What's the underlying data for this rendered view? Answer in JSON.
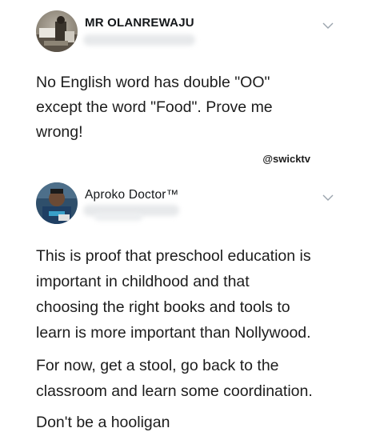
{
  "tweets": [
    {
      "author": "MR OLANREWAJU",
      "text": "No English word has double \"OO\"\nexcept the word \"Food\".  Prove me\nwrong!",
      "avatar_icon": "user-avatar-photo",
      "menu_icon": "chevron-down-icon"
    },
    {
      "author": "Aproko Doctor™",
      "paragraphs": [
        "This is proof that preschool education is\nimportant in childhood and that\nchoosing the right books and tools to\nlearn is more important than Nollywood.",
        "For now, get a stool, go back to the\nclassroom and learn some coordination.",
        "Don't be a hooligan"
      ],
      "avatar_icon": "user-avatar-photo",
      "menu_icon": "chevron-down-icon"
    }
  ],
  "watermark": "@swicktv"
}
